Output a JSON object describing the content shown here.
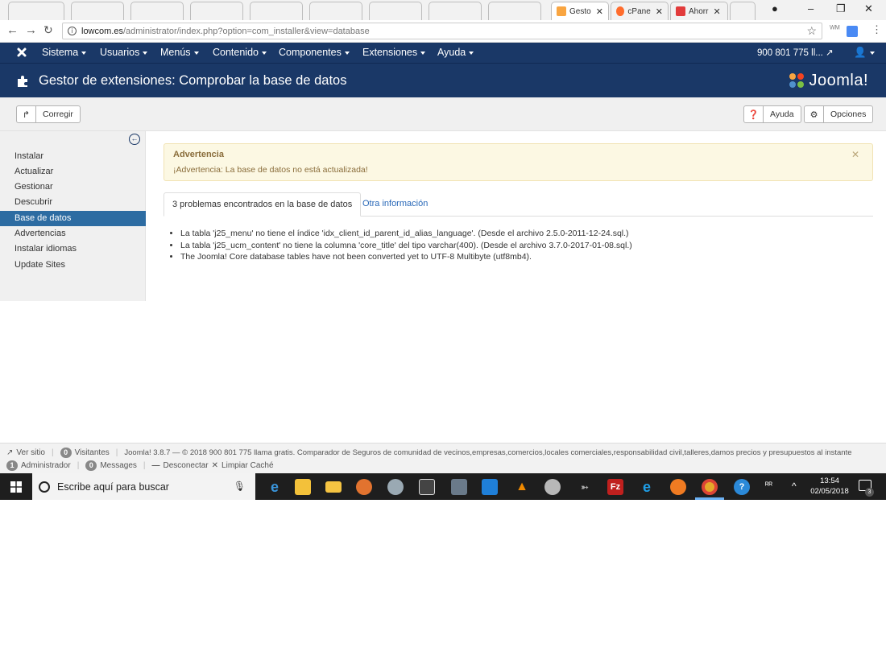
{
  "browser": {
    "tabs": [
      {
        "label": "Gesto",
        "active": true
      },
      {
        "label": "cPane",
        "active": false
      },
      {
        "label": "Ahorr",
        "active": false
      }
    ],
    "url_host": "lowcom.es",
    "url_path": "/administrator/index.php?option=com_installer&view=database"
  },
  "navbar": {
    "menus": [
      "Sistema",
      "Usuarios",
      "Menús",
      "Contenido",
      "Componentes",
      "Extensiones",
      "Ayuda"
    ],
    "site_link": "900 801 775 ll..."
  },
  "header": {
    "title": "Gestor de extensiones: Comprobar la base de datos",
    "logo_text": "Joomla!"
  },
  "toolbar": {
    "fix_label": "Corregir",
    "help_label": "Ayuda",
    "options_label": "Opciones"
  },
  "sidebar": {
    "items": [
      {
        "label": "Instalar",
        "active": false
      },
      {
        "label": "Actualizar",
        "active": false
      },
      {
        "label": "Gestionar",
        "active": false
      },
      {
        "label": "Descubrir",
        "active": false
      },
      {
        "label": "Base de datos",
        "active": true
      },
      {
        "label": "Advertencias",
        "active": false
      },
      {
        "label": "Instalar idiomas",
        "active": false
      },
      {
        "label": "Update Sites",
        "active": false
      }
    ]
  },
  "alert": {
    "title": "Advertencia",
    "message": "¡Advertencia: La base de datos no está actualizada!"
  },
  "tabs": {
    "problems": "3 problemas encontrados en la base de datos",
    "other_info": "Otra información"
  },
  "problems": [
    "La tabla 'j25_menu' no tiene el índice 'idx_client_id_parent_id_alias_language'. (Desde el archivo 2.5.0-2011-12-24.sql.)",
    "La tabla 'j25_ucm_content' no tiene la columna 'core_title' del tipo varchar(400). (Desde el archivo 3.7.0-2017-01-08.sql.)",
    "The Joomla! Core database tables have not been converted yet to UTF-8 Multibyte (utf8mb4)."
  ],
  "status": {
    "view_site": "Ver sitio",
    "visitors_count": "0",
    "visitors_label": "Visitantes",
    "footer_text": "Joomla! 3.8.7 — © 2018 900 801 775 llama gratis. Comparador de Seguros de comunidad de vecinos,empresas,comercios,locales comerciales,responsabilidad civil,talleres,damos precios y presupuestos al instante",
    "admin_count": "1",
    "admin_label": "Administrador",
    "messages_count": "0",
    "messages_label": "Messages",
    "logout_label": "Desconectar",
    "clear_cache_label": "Limpiar Caché"
  },
  "taskbar": {
    "search_placeholder": "Escribe aquí para buscar",
    "time": "13:54",
    "date": "02/05/2018",
    "notification_count": "3"
  },
  "colors": {
    "joomla_nav": "#1a3867",
    "active_sidebar": "#2d6ca2",
    "alert_bg": "#fcf8e3",
    "alert_text": "#8a6d3b",
    "link": "#2a69b8"
  }
}
